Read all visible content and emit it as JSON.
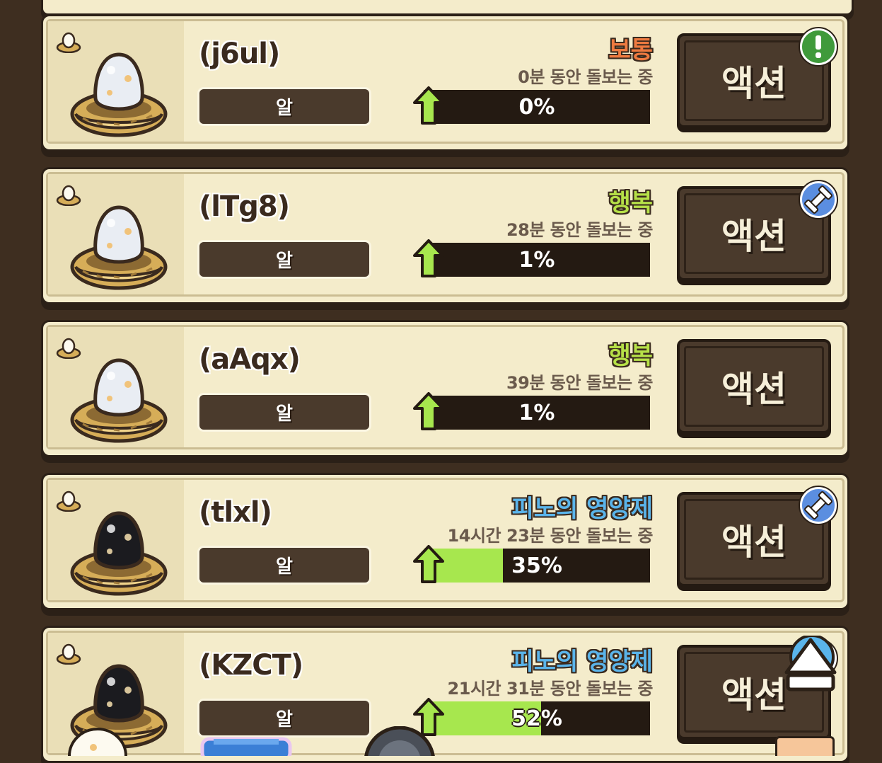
{
  "pets": [
    {
      "name": "(j6ul)",
      "type_label": "알",
      "status": "보통",
      "status_color": "orange",
      "care_time": "0분 동안 돌보는 중",
      "progress_text": "0%",
      "progress": 0,
      "action_label": "액션",
      "badge": "alert-icon",
      "egg": "white"
    },
    {
      "name": "(lTg8)",
      "type_label": "알",
      "status": "행복",
      "status_color": "green",
      "care_time": "28분 동안 돌보는 중",
      "progress_text": "1%",
      "progress": 0.01,
      "action_label": "액션",
      "badge": "dumbbell-icon",
      "egg": "white"
    },
    {
      "name": "(aAqx)",
      "type_label": "알",
      "status": "행복",
      "status_color": "green",
      "care_time": "39분 동안 돌보는 중",
      "progress_text": "1%",
      "progress": 0.01,
      "action_label": "액션",
      "badge": "",
      "egg": "white"
    },
    {
      "name": "(tlxl)",
      "type_label": "알",
      "status": "피노의 영양제",
      "status_color": "blue",
      "care_time": "14시간 23분 동안 돌보는 중",
      "progress_text": "35%",
      "progress": 0.35,
      "action_label": "액션",
      "badge": "dumbbell-icon",
      "egg": "black"
    },
    {
      "name": "(KZCT)",
      "type_label": "알",
      "status": "피노의 영양제",
      "status_color": "blue",
      "care_time": "21시간 31분 동안 돌보는 중",
      "progress_text": "52%",
      "progress": 0.52,
      "action_label": "액션",
      "badge": "dumbbell-icon",
      "egg": "black"
    }
  ],
  "colors": {
    "progress_fill": "#a7e74e",
    "card_bg": "#f4eccb",
    "button_bg": "#4a3a2c"
  }
}
